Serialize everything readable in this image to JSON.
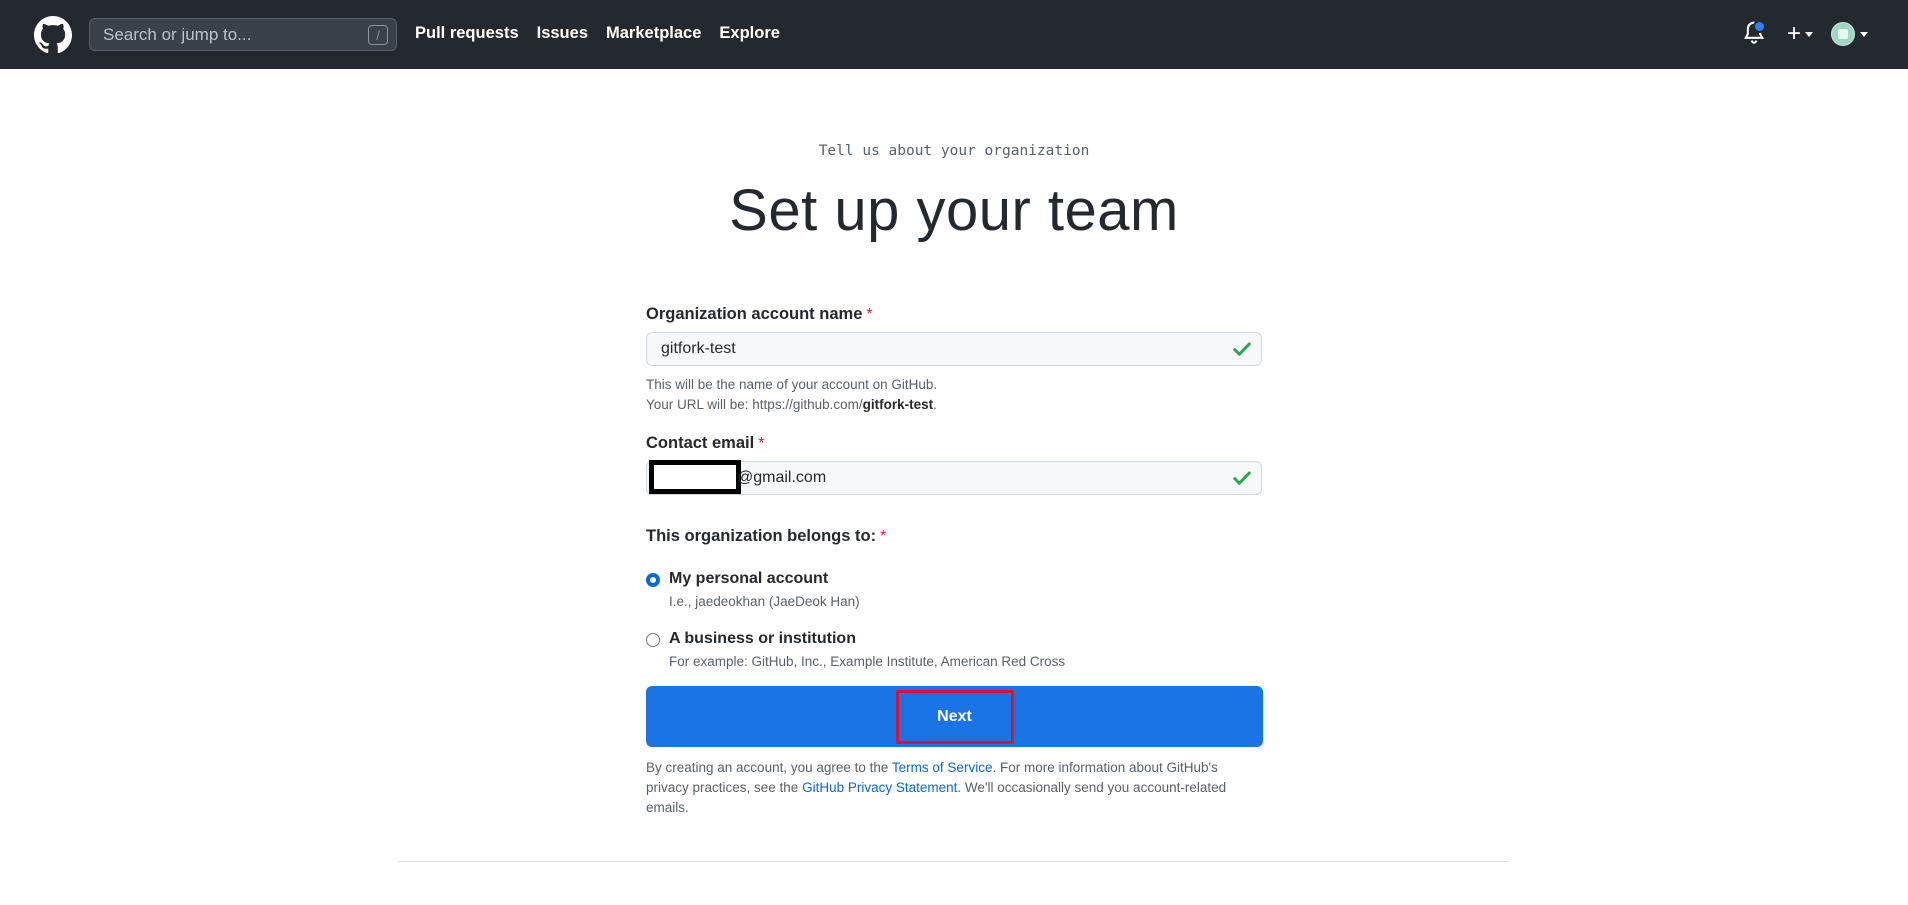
{
  "header": {
    "search_placeholder": "Search or jump to...",
    "search_shortcut": "/",
    "nav": [
      "Pull requests",
      "Issues",
      "Marketplace",
      "Explore"
    ],
    "plus_label": "+"
  },
  "page": {
    "subtitle": "Tell us about your organization",
    "title": "Set up your team"
  },
  "form": {
    "org_name": {
      "label": "Organization account name",
      "required": "*",
      "value": "gitfork-test",
      "note_line1": "This will be the name of your account on GitHub.",
      "note_line2_prefix": "Your URL will be: https://github.com/",
      "note_line2_bold": "gitfork-test",
      "note_line2_suffix": "."
    },
    "email": {
      "label": "Contact email",
      "required": "*",
      "value_visible": "@gmail.com"
    },
    "belongs": {
      "label": "This organization belongs to:",
      "required": "*",
      "options": [
        {
          "title": "My personal account",
          "desc": "I.e., jaedeokhan (JaeDeok Han)",
          "checked": true
        },
        {
          "title": "A business or institution",
          "desc": "For example: GitHub, Inc., Example Institute, American Red Cross",
          "checked": false
        }
      ]
    },
    "next_label": "Next"
  },
  "legal": {
    "part1": "By creating an account, you agree to the ",
    "terms_link": "Terms of Service",
    "part2": ". For more information about GitHub's privacy practices, see the ",
    "privacy_link": "GitHub Privacy Statement",
    "part3": ". We'll occasionally send you account-related emails."
  },
  "colors": {
    "header_bg": "#24292f",
    "primary_button": "#1a74e6",
    "link": "#0969da",
    "required": "#cf222e",
    "valid_check": "#2da44e",
    "highlight_box": "#e0102e"
  }
}
